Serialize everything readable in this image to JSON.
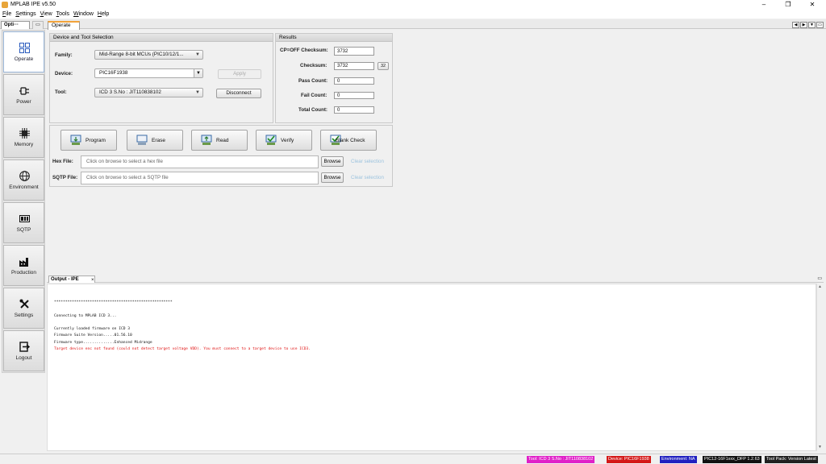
{
  "window": {
    "title": "MPLAB IPE v5.50",
    "controls": [
      "minimize",
      "restore",
      "close"
    ]
  },
  "menu": {
    "items": [
      {
        "label": "File",
        "accel": "F"
      },
      {
        "label": "Settings",
        "accel": "S"
      },
      {
        "label": "View",
        "accel": "V"
      },
      {
        "label": "Tools",
        "accel": "T"
      },
      {
        "label": "Window",
        "accel": "W"
      },
      {
        "label": "Help",
        "accel": "H"
      }
    ]
  },
  "tabs": {
    "left_panel": "Opti···",
    "main": "Operate"
  },
  "sidebar": {
    "items": [
      {
        "label": "Operate",
        "icon": "grid-icon",
        "active": true
      },
      {
        "label": "Power",
        "icon": "power-plug-icon",
        "active": false
      },
      {
        "label": "Memory",
        "icon": "chip-icon",
        "active": false
      },
      {
        "label": "Environment",
        "icon": "globe-icon",
        "active": false
      },
      {
        "label": "SQTP",
        "icon": "sqtp-icon",
        "active": false
      },
      {
        "label": "Production",
        "icon": "factory-icon",
        "active": false
      },
      {
        "label": "Settings",
        "icon": "tools-icon",
        "active": false
      },
      {
        "label": "Logout",
        "icon": "logout-icon",
        "active": false
      }
    ]
  },
  "device_tool": {
    "header": "Device and Tool Selection",
    "family_label": "Family:",
    "family_value": "Mid-Range 8-bit MCUs (PIC10/12/1...",
    "device_label": "Device:",
    "device_value": "PIC16F1938",
    "apply_label": "Apply",
    "tool_label": "Tool:",
    "tool_value": "ICD 3 S.No : JIT110838102",
    "disconnect_label": "Disconnect"
  },
  "results": {
    "header": "Results",
    "cp_off_label": "CP=OFF Checksum:",
    "cp_off_value": "3732",
    "checksum_label": "Checksum:",
    "checksum_value": "3732",
    "checksum_button": "32",
    "pass_label": "Pass Count:",
    "pass_value": "0",
    "fail_label": "Fail Count:",
    "fail_value": "0",
    "total_label": "Total Count:",
    "total_value": "0"
  },
  "actions": {
    "program": "Program",
    "erase": "Erase",
    "read": "Read",
    "verify": "Verify",
    "blank_check": "Blank Check"
  },
  "files": {
    "hex_label": "Hex File:",
    "hex_placeholder": "Click on browse to select a hex file",
    "sqtp_label": "SQTP File:",
    "sqtp_placeholder": "Click on browse to select a SQTP file",
    "browse_label": "Browse",
    "clear_label": "Clear selection"
  },
  "output": {
    "tab_label": "Output - IPE",
    "close_glyph": "×",
    "lines": [
      {
        "text": "*****************************************************",
        "error": false
      },
      {
        "text": "Connecting to MPLAB ICD 3...",
        "error": false
      },
      {
        "text": "Currently loaded firmware on ICD 3",
        "error": false
      },
      {
        "text": "Firmware Suite Version.....01.56.10",
        "error": false
      },
      {
        "text": "Firmware type..............Enhanced Midrange",
        "error": false
      },
      {
        "text": "Target device enc not found (could not detect target voltage VDD). You must connect to a target device to use ICD3.",
        "error": true
      }
    ]
  },
  "status": {
    "tool": "Tool: ICD 3 S.No : JIT110838102",
    "device": "Device: PIC16F1938",
    "environment": "Environment: NA",
    "dfp": "PIC12-16F1xxx_DFP 1.2.63",
    "tool_pack": "Tool Pack: Version Latest",
    "colors": {
      "tool": "#e020c8",
      "device": "#d41818",
      "environment": "#2020c0",
      "dfp": "#101010",
      "tool_pack": "#202020"
    }
  }
}
